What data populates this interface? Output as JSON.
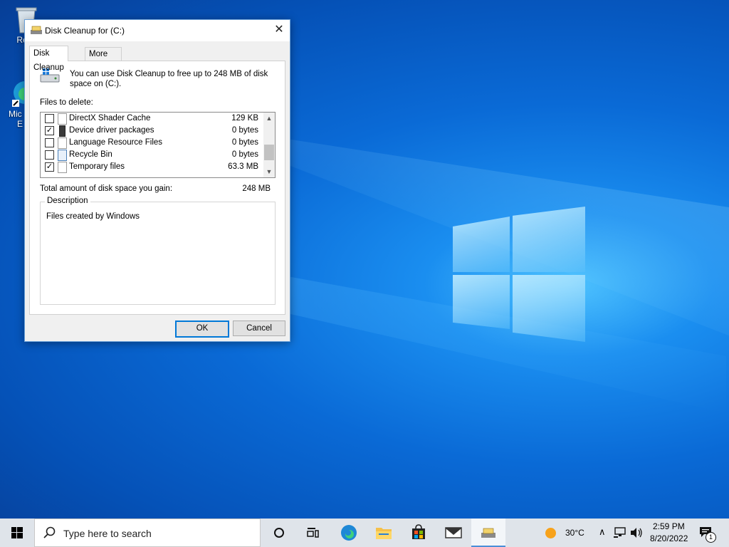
{
  "desktop": {
    "icons": [
      {
        "label": "Recy"
      },
      {
        "label": "Mic"
      },
      {
        "label": "E"
      }
    ]
  },
  "dialog": {
    "title": "Disk Cleanup for  (C:)",
    "close_glyph": "✕",
    "tabs": [
      {
        "label": "Disk Cleanup",
        "active": true
      },
      {
        "label": "More Options",
        "active": false
      }
    ],
    "intro": "You can use Disk Cleanup to free up to 248 MB of disk space on  (C:).",
    "files_label": "Files to delete:",
    "files": [
      {
        "name": "DirectX Shader Cache",
        "size": "129 KB",
        "checked": false
      },
      {
        "name": "Device driver packages",
        "size": "0 bytes",
        "checked": true
      },
      {
        "name": "Language Resource Files",
        "size": "0 bytes",
        "checked": false
      },
      {
        "name": "Recycle Bin",
        "size": "0 bytes",
        "checked": false
      },
      {
        "name": "Temporary files",
        "size": "63.3 MB",
        "checked": true
      }
    ],
    "total_label": "Total amount of disk space you gain:",
    "total_value": "248 MB",
    "description_title": "Description",
    "description_text": "Files created by Windows",
    "ok_label": "OK",
    "cancel_label": "Cancel"
  },
  "taskbar": {
    "search_placeholder": "Type here to search",
    "weather": "30°C",
    "time": "2:59 PM",
    "date": "8/20/2022",
    "notification_count": "1"
  },
  "colors": {
    "accent": "#0078d7",
    "taskbar": "#dfe4ea",
    "dialog_bg": "#f0f0f0"
  }
}
